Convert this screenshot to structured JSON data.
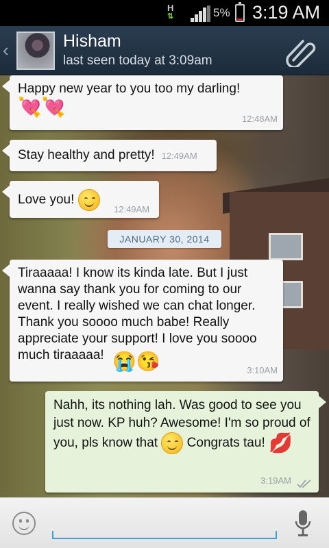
{
  "status_bar": {
    "network": "H",
    "battery_percent": "5%",
    "time": "3:19 AM"
  },
  "header": {
    "contact_name": "Hisham",
    "last_seen": "last seen today at 3:09am"
  },
  "messages": [
    {
      "direction": "in",
      "text": "Happy new year to you too my darling!",
      "emoji": "💘💘",
      "time": "12:48AM"
    },
    {
      "direction": "in",
      "text": "Stay healthy and pretty!",
      "time": "12:49AM"
    },
    {
      "direction": "in",
      "text": "Love you!",
      "emoji": "smile",
      "time": "12:49AM"
    },
    {
      "direction": "in",
      "text": "Tiraaaaa! I know its kinda late. But I just wanna say thank you for coming to our event. I really wished we can chat longer. Thank you soooo much babe! Really appreciate your support! I love you soooo much tiraaaaa!",
      "emoji": "😭😘",
      "time": "3:10AM"
    },
    {
      "direction": "out",
      "text_part1": "Nahh, its nothing lah. Was good to see you just now. KP huh? Awesome! I'm so proud of you, pls know that",
      "text_part2": "Congrats tau!",
      "emoji": "💋",
      "time": "3:19AM",
      "status": "read"
    }
  ],
  "date_divider": "JANUARY 30, 2014",
  "input": {
    "placeholder": "",
    "value": ""
  },
  "colors": {
    "action_bar": "#24364a",
    "incoming_bubble": "#f6f6f6",
    "outgoing_bubble": "#e6f2da",
    "input_underline": "#3aa0d6"
  },
  "icons": [
    "back-chevron-icon",
    "attach-paperclip-icon",
    "emoji-icon",
    "microphone-icon",
    "read-ticks-icon"
  ]
}
